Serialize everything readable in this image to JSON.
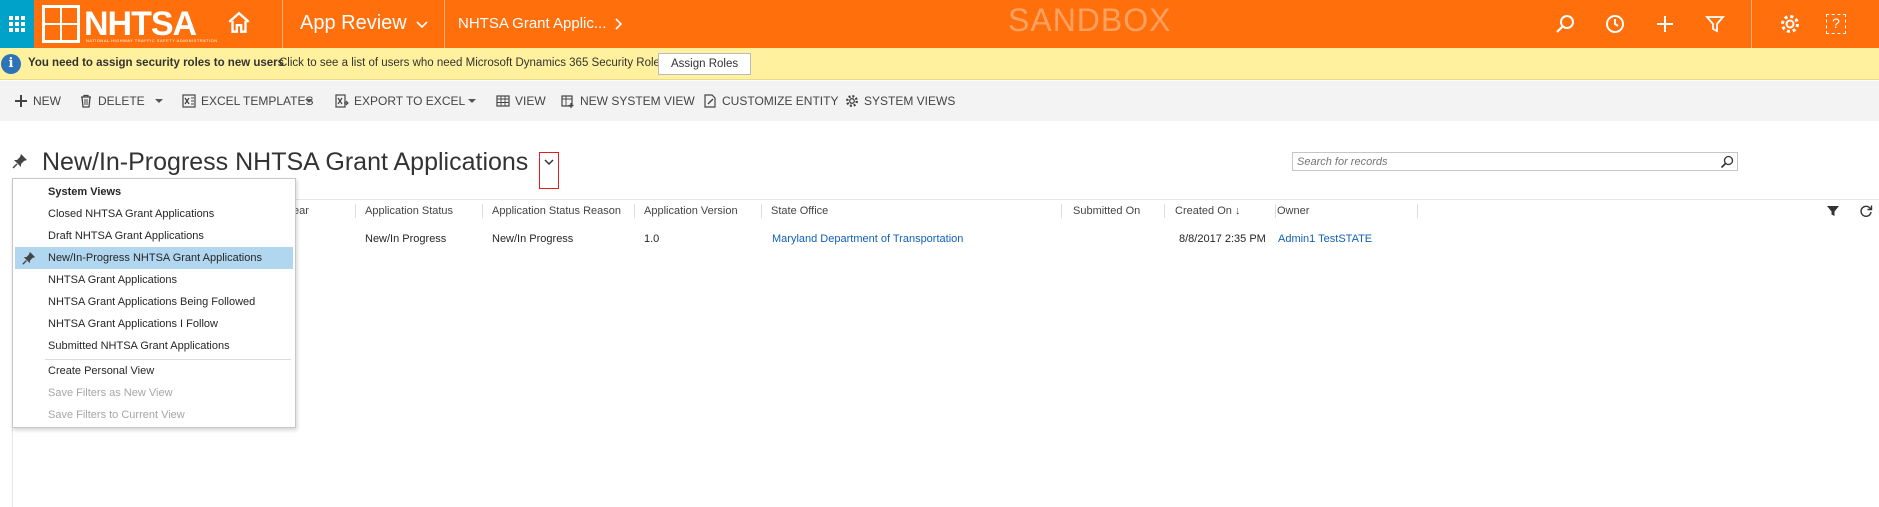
{
  "nav": {
    "logo_text": "NHTSA",
    "logo_sub": "NATIONAL HIGHWAY TRAFFIC SAFETY ADMINISTRATION",
    "app_title": "App Review",
    "breadcrumb": "NHTSA Grant Applic...",
    "environment": "SANDBOX",
    "icons": [
      "waffle-icon",
      "home-icon",
      "search-icon",
      "history-icon",
      "plus-icon",
      "filter-icon",
      "gear-icon",
      "help-icon"
    ],
    "help_glyph": "?"
  },
  "notification": {
    "bold_text": "You need to assign security roles to new users",
    "message": "Click to see a list of users who need Microsoft Dynamics 365 Security Roles.",
    "button_label": "Assign Roles",
    "info_glyph": "i"
  },
  "commands": {
    "new": "NEW",
    "delete": "DELETE",
    "excel_templates": "EXCEL TEMPLATES",
    "export_to_excel": "EXPORT TO EXCEL",
    "view": "VIEW",
    "new_system_view": "NEW SYSTEM VIEW",
    "customize_entity": "CUSTOMIZE ENTITY",
    "system_views": "SYSTEM VIEWS"
  },
  "view": {
    "title": "New/In-Progress NHTSA Grant Applications",
    "search_placeholder": "Search for records"
  },
  "grid": {
    "columns": [
      "ear",
      "Application Status",
      "Application Status Reason",
      "Application Version",
      "State Office",
      "Submitted On",
      "Created On",
      "Owner"
    ],
    "sort_glyph": "↓",
    "rows": [
      {
        "status": "New/In Progress",
        "status_reason": "New/In Progress",
        "version": "1.0",
        "state_office": "Maryland Department of Transportation",
        "submitted_on": "",
        "created_on": "8/8/2017 2:35 PM",
        "owner": "Admin1 TestSTATE"
      }
    ]
  },
  "view_menu": {
    "header": "System Views",
    "items": [
      "Closed NHTSA Grant Applications",
      "Draft NHTSA Grant Applications",
      "New/In-Progress NHTSA Grant Applications",
      "NHTSA Grant Applications",
      "NHTSA Grant Applications Being Followed",
      "NHTSA Grant Applications I Follow",
      "Submitted NHTSA Grant Applications"
    ],
    "selected_index": 2,
    "actions": [
      "Create Personal View",
      "Save Filters as New View",
      "Save Filters to Current View"
    ]
  },
  "colors": {
    "nav_bg": "#ff6f0c",
    "waffle_bg": "#00a2c9",
    "notification_bg": "#fff19d",
    "selected_bg": "#b1d6f0",
    "link": "#1160b7",
    "highlight_border": "#e0201f"
  }
}
